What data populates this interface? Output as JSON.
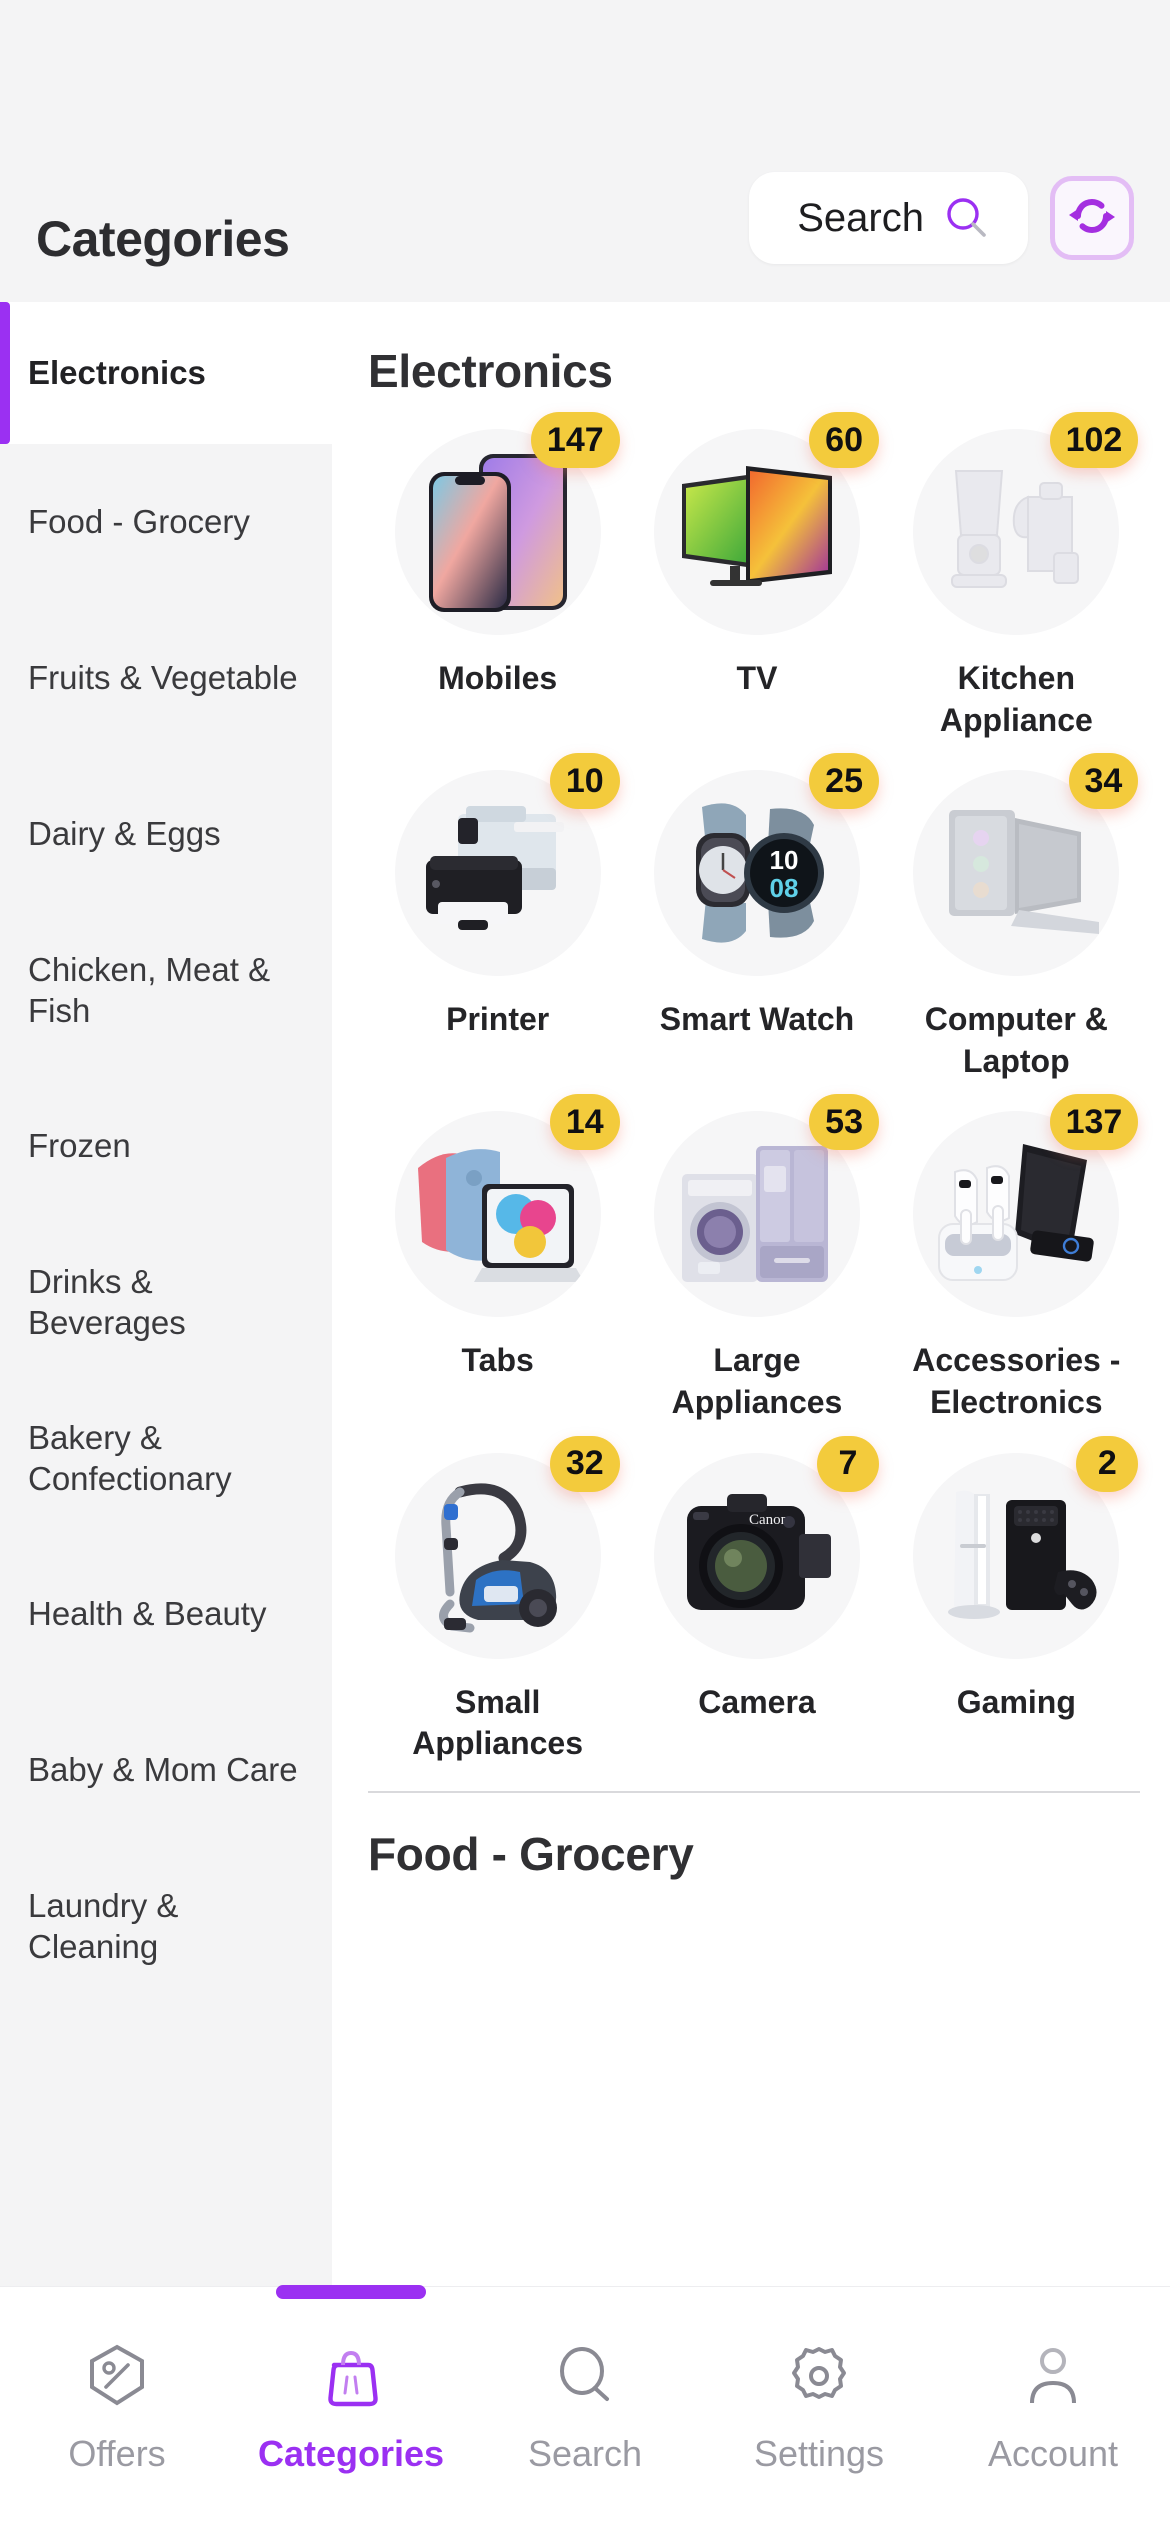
{
  "header": {
    "title": "Categories",
    "search_label": "Search",
    "search_icon": "search-icon",
    "refresh_icon": "refresh-sync-icon"
  },
  "sidebar": {
    "items": [
      {
        "label": "Electronics",
        "active": true
      },
      {
        "label": "Food - Grocery",
        "active": false
      },
      {
        "label": "Fruits & Vegetable",
        "active": false
      },
      {
        "label": "Dairy & Eggs",
        "active": false
      },
      {
        "label": "Chicken, Meat & Fish",
        "active": false
      },
      {
        "label": "Frozen",
        "active": false
      },
      {
        "label": "Drinks & Beverages",
        "active": false
      },
      {
        "label": "Bakery & Confectionary",
        "active": false
      },
      {
        "label": "Health & Beauty",
        "active": false
      },
      {
        "label": "Baby & Mom Care",
        "active": false
      },
      {
        "label": "Laundry & Cleaning",
        "active": false
      }
    ]
  },
  "content": {
    "section_title": "Electronics",
    "next_section_title": "Food - Grocery",
    "tiles": [
      {
        "label": "Mobiles",
        "count": "147",
        "icon": "mobile-phones-icon"
      },
      {
        "label": "TV",
        "count": "60",
        "icon": "television-icon"
      },
      {
        "label": "Kitchen Appliance",
        "count": "102",
        "icon": "blender-kettle-icon"
      },
      {
        "label": "Printer",
        "count": "10",
        "icon": "printer-icon"
      },
      {
        "label": "Smart Watch",
        "count": "25",
        "icon": "smartwatch-icon"
      },
      {
        "label": "Computer & Laptop",
        "count": "34",
        "icon": "laptop-desktop-icon"
      },
      {
        "label": "Tabs",
        "count": "14",
        "icon": "tablet-icon"
      },
      {
        "label": "Large Appliances",
        "count": "53",
        "icon": "washer-fridge-icon"
      },
      {
        "label": "Accessories - Electronics",
        "count": "137",
        "icon": "earbuds-charger-icon"
      },
      {
        "label": "Small Appliances",
        "count": "32",
        "icon": "vacuum-cleaner-icon"
      },
      {
        "label": "Camera",
        "count": "7",
        "icon": "dslr-camera-icon"
      },
      {
        "label": "Gaming",
        "count": "2",
        "icon": "game-console-icon"
      }
    ]
  },
  "tabbar": {
    "items": [
      {
        "label": "Offers",
        "icon": "offer-tag-icon",
        "active": false
      },
      {
        "label": "Categories",
        "icon": "shopping-bag-icon",
        "active": true
      },
      {
        "label": "Search",
        "icon": "search-icon",
        "active": false
      },
      {
        "label": "Settings",
        "icon": "gear-icon",
        "active": false
      },
      {
        "label": "Account",
        "icon": "person-icon",
        "active": false
      }
    ]
  },
  "colors": {
    "accent": "#9b30f2",
    "badge": "#f3cb3c",
    "header_bg": "#f4f4f5",
    "muted_text": "#9a9aa2"
  }
}
